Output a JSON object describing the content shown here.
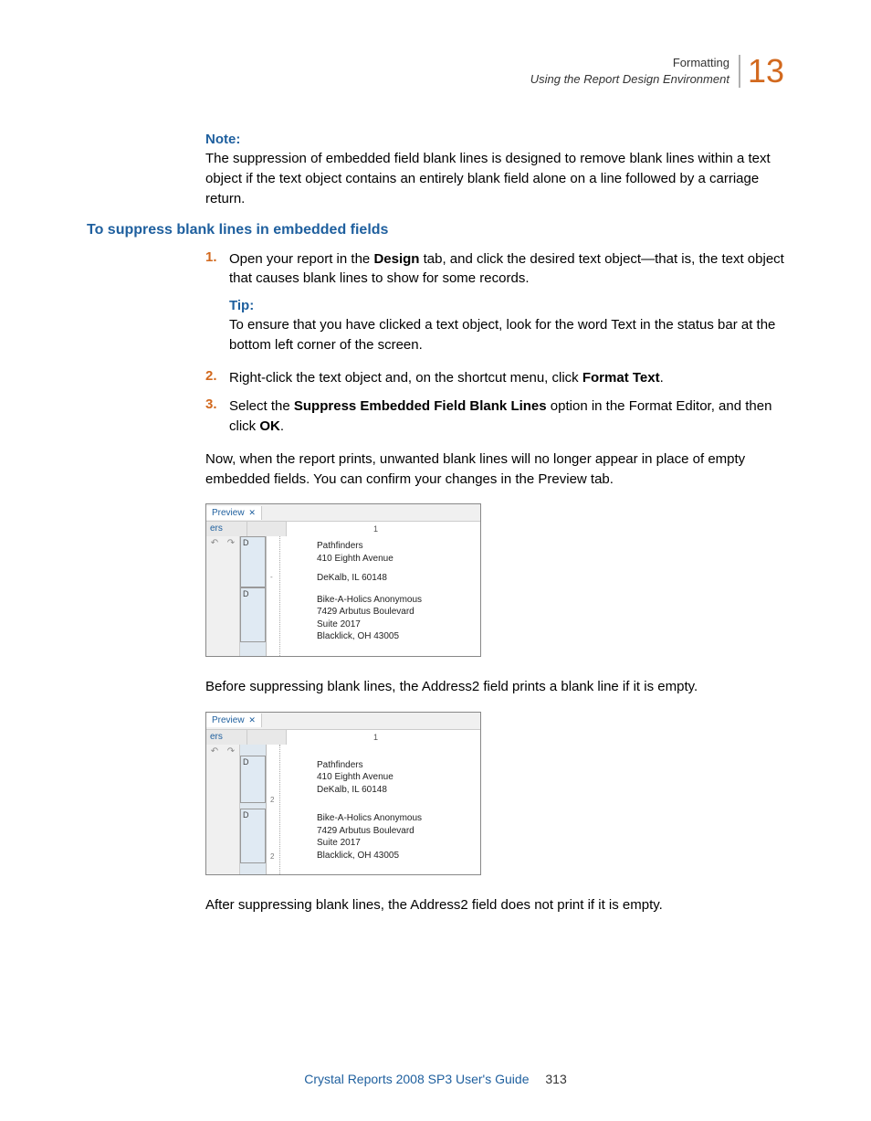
{
  "header": {
    "line1": "Formatting",
    "line2": "Using the Report Design Environment",
    "chapter": "13"
  },
  "note": {
    "label": "Note:",
    "body": "The suppression of embedded field blank lines is designed to remove blank lines within a text object if the text object contains an entirely blank field alone on a line followed by a carriage return."
  },
  "section_heading": "To suppress blank lines in embedded fields",
  "steps": [
    {
      "num": "1.",
      "text_before": "Open your report in the ",
      "bold1": "Design",
      "text_after": " tab, and click the desired text object—that is, the text object that causes blank lines to show for some records."
    },
    {
      "num": "2.",
      "text_before": "Right-click the text object and, on the shortcut menu, click ",
      "bold1": "Format Text",
      "text_after": "."
    },
    {
      "num": "3.",
      "text_before": "Select the ",
      "bold1": "Suppress Embedded Field Blank Lines",
      "text_mid": " option in the Format Editor, and then click ",
      "bold2": "OK",
      "text_after": "."
    }
  ],
  "tip": {
    "label": "Tip:",
    "body": "To ensure that you have clicked a text object, look for the word Text in the status bar at the bottom left corner of the screen."
  },
  "result_paragraph": "Now, when the report prints, unwanted blank lines will no longer appear in place of empty embedded fields. You can confirm your changes in the Preview tab.",
  "screenshot1": {
    "tab": "Preview",
    "ers": "ers",
    "section_label": "D",
    "ruler_mark": "1",
    "group1": {
      "l1": "Pathfinders",
      "l2": "410 Eighth Avenue",
      "l3": "DeKalb, IL 60148"
    },
    "group2": {
      "l1": "Bike-A-Holics Anonymous",
      "l2": "7429 Arbutus Boulevard",
      "l3": "Suite 2017",
      "l4": "Blacklick, OH 43005"
    }
  },
  "caption1": "Before suppressing blank lines, the Address2 field prints a blank line if it is empty.",
  "screenshot2": {
    "tab": "Preview",
    "ers": "ers",
    "section_label": "D",
    "ruler_mark": "1",
    "group1": {
      "l1": "Pathfinders",
      "l2": "410 Eighth Avenue",
      "l3": "DeKalb, IL 60148"
    },
    "group2": {
      "l1": "Bike-A-Holics Anonymous",
      "l2": "7429 Arbutus Boulevard",
      "l3": "Suite 2017",
      "l4": "Blacklick, OH 43005"
    }
  },
  "caption2": "After suppressing blank lines, the Address2 field does not print if it is empty.",
  "footer": {
    "title": "Crystal Reports 2008 SP3 User's Guide",
    "page": "313"
  }
}
